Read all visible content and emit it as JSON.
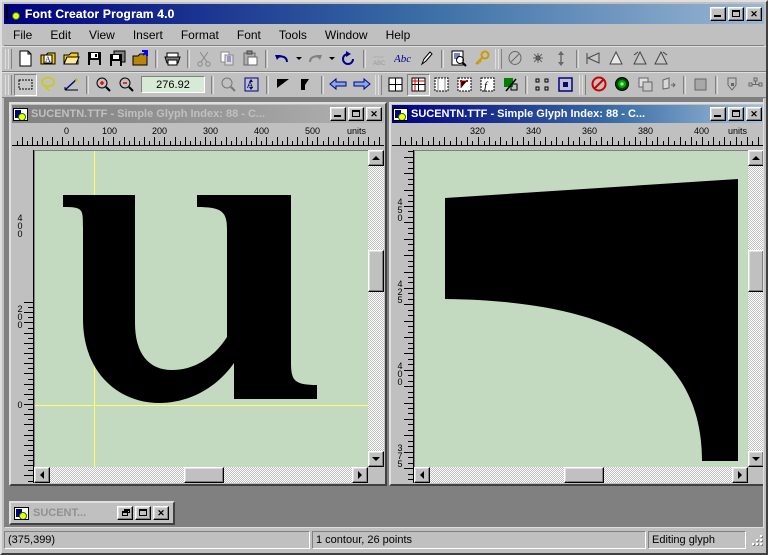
{
  "app": {
    "title": "Font Creator Program 4.0",
    "icon": "font-creator-app-icon",
    "window_buttons": {
      "minimize": "_",
      "maximize": "□",
      "close": "✕"
    }
  },
  "menu": {
    "items": [
      {
        "label": "File",
        "accel": "F"
      },
      {
        "label": "Edit",
        "accel": "E"
      },
      {
        "label": "View",
        "accel": "V"
      },
      {
        "label": "Insert",
        "accel": "I"
      },
      {
        "label": "Format",
        "accel": "o"
      },
      {
        "label": "Font",
        "accel": "t"
      },
      {
        "label": "Tools",
        "accel": "l"
      },
      {
        "label": "Window",
        "accel": "W"
      },
      {
        "label": "Help",
        "accel": "H"
      }
    ]
  },
  "toolbar_standard": {
    "buttons": [
      {
        "name": "new-icon",
        "tip": "New"
      },
      {
        "name": "open-font-icon",
        "tip": "Open Font"
      },
      {
        "name": "open-folder-icon",
        "tip": "Open"
      },
      {
        "name": "save-icon",
        "tip": "Save"
      },
      {
        "name": "save-all-icon",
        "tip": "Save All"
      },
      {
        "name": "install-font-icon",
        "tip": "Install Font"
      },
      {
        "name": "print-icon",
        "tip": "Print"
      },
      {
        "name": "cut-icon",
        "tip": "Cut"
      },
      {
        "name": "copy-icon",
        "tip": "Copy"
      },
      {
        "name": "paste-icon",
        "tip": "Paste"
      },
      {
        "name": "undo-icon",
        "tip": "Undo"
      },
      {
        "name": "redo-icon",
        "tip": "Redo"
      },
      {
        "name": "refresh-icon",
        "tip": "Refresh"
      },
      {
        "name": "spelling-icon",
        "tip": "Validate"
      },
      {
        "name": "abc-icon",
        "tip": "Test Font"
      },
      {
        "name": "pen-icon",
        "tip": "Edit Glyph"
      },
      {
        "name": "preview-icon",
        "tip": "Preview"
      },
      {
        "name": "key-icon",
        "tip": "Properties"
      },
      {
        "name": "eraser-icon",
        "tip": "Clear"
      },
      {
        "name": "transform-icon",
        "tip": "Transform"
      },
      {
        "name": "stretch-icon",
        "tip": "Stretch"
      },
      {
        "name": "flip-horizontal-icon",
        "tip": "Flip Horizontal"
      },
      {
        "name": "flip-vertical-icon",
        "tip": "Flip Vertical"
      },
      {
        "name": "rotate-left-icon",
        "tip": "Rotate Left"
      },
      {
        "name": "rotate-right-icon",
        "tip": "Rotate Right"
      }
    ]
  },
  "toolbar_glyph": {
    "zoom_value": "276.92",
    "buttons": [
      {
        "name": "select-tool-icon",
        "tip": "Select"
      },
      {
        "name": "lasso-tool-icon",
        "tip": "Lasso"
      },
      {
        "name": "measure-tool-icon",
        "tip": "Measure"
      },
      {
        "name": "zoom-in-icon",
        "tip": "Zoom In"
      },
      {
        "name": "zoom-out-icon",
        "tip": "Zoom Out"
      },
      {
        "name": "zoom-tool-icon",
        "tip": "Zoom"
      },
      {
        "name": "fit-window-icon",
        "tip": "Fit to Window"
      },
      {
        "name": "fill-contour-icon",
        "tip": "Fill"
      },
      {
        "name": "split-contour-icon",
        "tip": "Split"
      },
      {
        "name": "previous-glyph-icon",
        "tip": "Previous Glyph"
      },
      {
        "name": "next-glyph-icon",
        "tip": "Next Glyph"
      },
      {
        "name": "show-grid-icon",
        "tip": "Show Grid"
      },
      {
        "name": "show-guides-icon",
        "tip": "Show Guidelines"
      },
      {
        "name": "show-metrics-icon",
        "tip": "Show Metrics"
      },
      {
        "name": "show-points-icon",
        "tip": "Show Points"
      },
      {
        "name": "show-outline-icon",
        "tip": "Show Outline"
      },
      {
        "name": "show-fill-icon",
        "tip": "Show Fill"
      },
      {
        "name": "show-nodes-icon",
        "tip": "Show Nodes"
      },
      {
        "name": "show-bbox-icon",
        "tip": "Show Bounding Box"
      },
      {
        "name": "no-snap-icon",
        "tip": "Disable Snap"
      },
      {
        "name": "snap-grid-icon",
        "tip": "Snap to Grid"
      },
      {
        "name": "duplicate-icon",
        "tip": "Duplicate"
      },
      {
        "name": "export-icon",
        "tip": "Export"
      },
      {
        "name": "solid-fill-icon",
        "tip": "Solid"
      },
      {
        "name": "add-point-icon",
        "tip": "Add Point"
      },
      {
        "name": "connect-points-icon",
        "tip": "Connect"
      },
      {
        "name": "curve-tool-icon",
        "tip": "Curve"
      }
    ]
  },
  "windows": [
    {
      "id": "left",
      "title": "SUCENTN.TTF - Simple Glyph Index: 88 - C...",
      "active": false,
      "icon": "glyph-window-icon",
      "units_label": "units",
      "h_ruler_labels": [
        "0",
        "100",
        "200",
        "300",
        "400",
        "500"
      ],
      "v_ruler_labels": [
        "400",
        "200",
        "0"
      ],
      "glyph": "u",
      "buttons": {
        "minimize": "_",
        "maximize": "□",
        "close": "✕"
      }
    },
    {
      "id": "right",
      "title": "SUCENTN.TTF - Simple Glyph Index: 88 - C...",
      "active": true,
      "icon": "glyph-window-icon",
      "units_label": "units",
      "h_ruler_labels": [
        "320",
        "340",
        "360",
        "380",
        "400"
      ],
      "v_ruler_labels": [
        "450",
        "425",
        "400",
        "375"
      ],
      "glyph": "u-detail",
      "buttons": {
        "minimize": "_",
        "maximize": "□",
        "close": "✕"
      }
    }
  ],
  "minimized_window": {
    "title": "SUCENT...",
    "icon": "glyph-window-icon",
    "buttons": {
      "restore": "❐",
      "maximize": "□",
      "close": "✕"
    }
  },
  "statusbar": {
    "coordinates": "(375,399)",
    "contour_info": "1 contour, 26 points",
    "mode": "Editing glyph"
  },
  "colors": {
    "face": "#c0c0c0",
    "title_active_start": "#00007e",
    "title_inactive_start": "#808080",
    "canvas": "#c3d9c0",
    "guide": "#ffff66",
    "glyph_fill": "#000000",
    "field_bg": "#d6ead6",
    "desktop": "#808080"
  }
}
